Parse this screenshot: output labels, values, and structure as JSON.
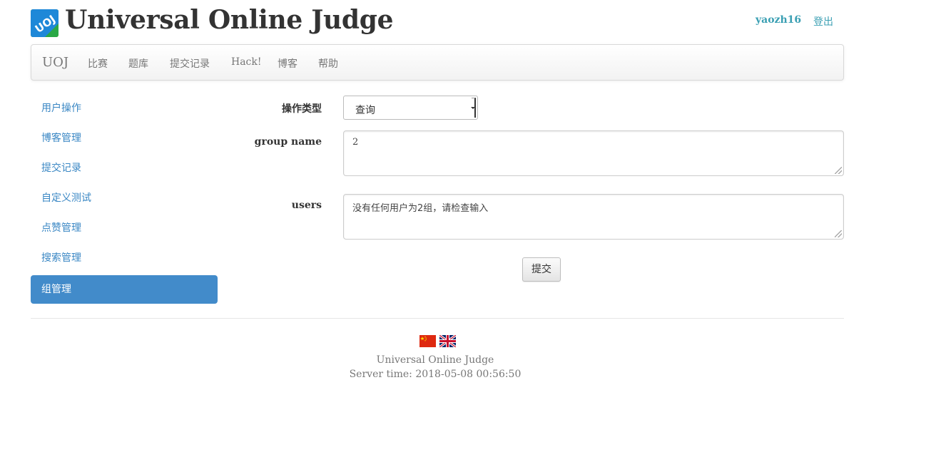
{
  "header": {
    "logo_text": "UOJ",
    "title": "Universal Online Judge",
    "username": "yaozh16",
    "logout_label": "登出"
  },
  "navbar": {
    "brand": "UOJ",
    "items": [
      {
        "label": "比赛"
      },
      {
        "label": "题库"
      },
      {
        "label": "提交记录"
      },
      {
        "label": "Hack!"
      },
      {
        "label": "博客"
      },
      {
        "label": "帮助"
      }
    ]
  },
  "sidebar": {
    "items": [
      {
        "label": "用户操作",
        "active": false
      },
      {
        "label": "博客管理",
        "active": false
      },
      {
        "label": "提交记录",
        "active": false
      },
      {
        "label": "自定义测试",
        "active": false
      },
      {
        "label": "点赞管理",
        "active": false
      },
      {
        "label": "搜索管理",
        "active": false
      },
      {
        "label": "组管理",
        "active": true
      }
    ]
  },
  "form": {
    "op_type_label": "操作类型",
    "op_type_value": "查询",
    "group_name_label": "group name",
    "group_name_value": "2",
    "users_label": "users",
    "users_value": "没有任何用户为2组，请检查输入",
    "submit_label": "提交"
  },
  "footer": {
    "flags": [
      "china-flag",
      "uk-flag"
    ],
    "site_name": "Universal Online Judge",
    "server_time": "Server time: 2018-05-08 00:56:50"
  },
  "colors": {
    "link": "#3a87c4",
    "accent": "#428bca",
    "username": "#3a9fb3"
  }
}
